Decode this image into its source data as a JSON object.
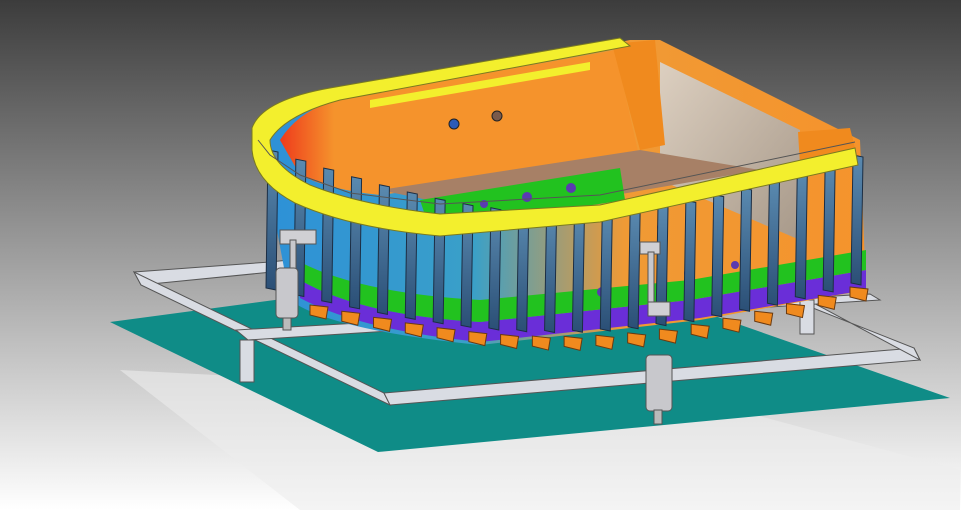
{
  "viewport": {
    "background_top": "#3c3c3c",
    "background_bottom": "#ffffff"
  },
  "colors": {
    "deck_plate": "#0f8c87",
    "frame_tube": "#d9dce3",
    "rim": "#f3ef2d",
    "inner_wall": "#f5932c",
    "inner_wall_curve": "#ee3b1c",
    "bottom_band_green": "#22c21f",
    "bottom_band_purple": "#6a2ed8",
    "deck_brown": "#a78066",
    "flange_orange": "#f08a1e",
    "glass": "#b8b8b8",
    "actuator": "#c8c8cc"
  },
  "model": {
    "parts": [
      "deck-plate",
      "support-frame",
      "hull-shell",
      "yellow-rim",
      "bulkhead-ribs",
      "hydraulic-actuator-left",
      "hydraulic-actuator-right"
    ]
  }
}
